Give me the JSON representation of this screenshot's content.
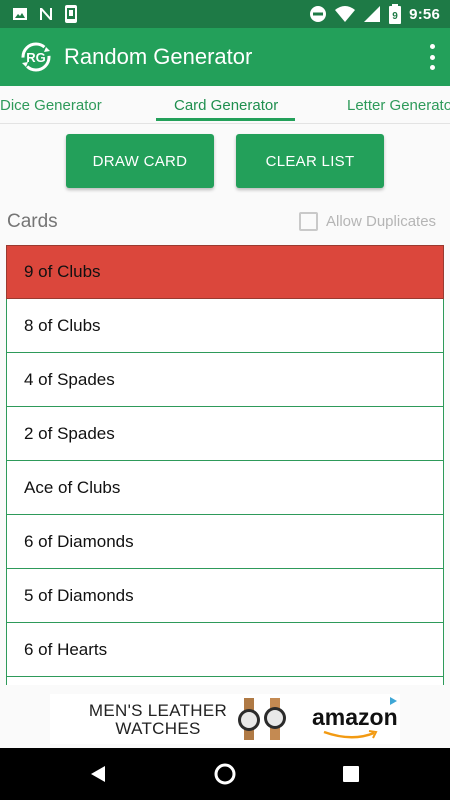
{
  "status_bar": {
    "time": "9:56",
    "battery_level": "9",
    "icons": [
      "image-icon",
      "n-icon",
      "phone-icon",
      "dnd-icon",
      "wifi-icon",
      "signal-icon",
      "battery-icon"
    ]
  },
  "app_bar": {
    "logo_text": "RG",
    "title": "Random Generator",
    "overflow_icon": "more-vert-icon"
  },
  "tabs": [
    {
      "label": "Dice Generator",
      "selected": false
    },
    {
      "label": "Card Generator",
      "selected": true
    },
    {
      "label": "Letter Generator",
      "selected": false
    }
  ],
  "buttons": {
    "draw": "DRAW CARD",
    "clear": "CLEAR LIST"
  },
  "cards_section": {
    "label": "Cards",
    "allow_duplicates_label": "Allow Duplicates",
    "allow_duplicates_checked": false
  },
  "cards": [
    {
      "label": "9 of Clubs",
      "highlighted": true
    },
    {
      "label": "8 of Clubs",
      "highlighted": false
    },
    {
      "label": "4 of Spades",
      "highlighted": false
    },
    {
      "label": "2 of Spades",
      "highlighted": false
    },
    {
      "label": "Ace of Clubs",
      "highlighted": false
    },
    {
      "label": "6 of Diamonds",
      "highlighted": false
    },
    {
      "label": "5 of Diamonds",
      "highlighted": false
    },
    {
      "label": "6 of Hearts",
      "highlighted": false
    },
    {
      "label": "",
      "highlighted": false
    }
  ],
  "ad": {
    "line1": "MEN'S LEATHER",
    "line2": "WATCHES",
    "brand": "amazon"
  },
  "colors": {
    "primary": "#23a05a",
    "primary_dark": "#1e7a46",
    "highlight": "#db473c",
    "list_border": "#2e9a5a"
  }
}
